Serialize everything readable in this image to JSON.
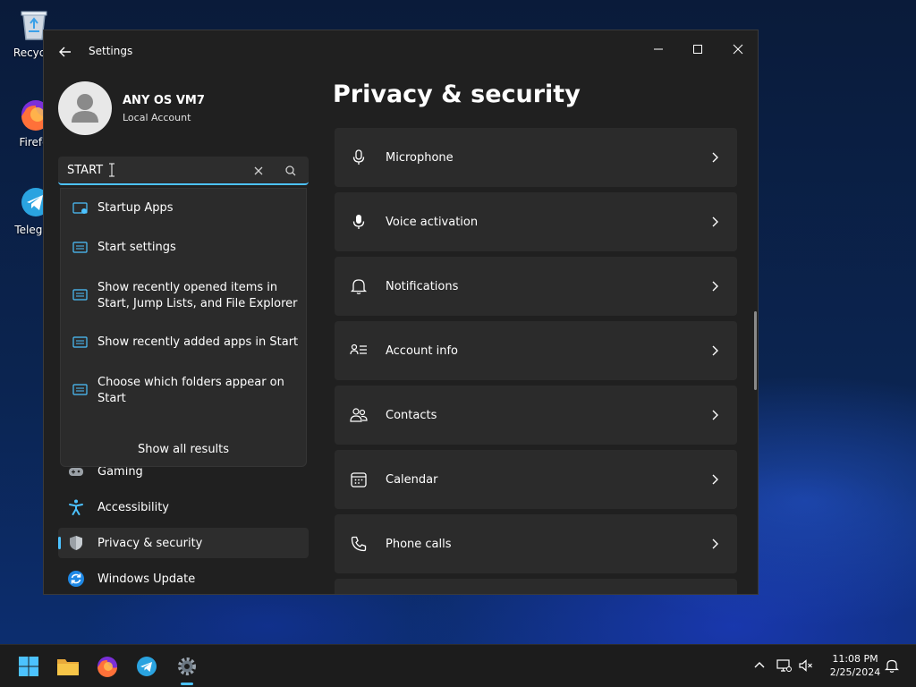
{
  "desktop": {
    "icons": [
      {
        "label": "Recycle",
        "icon": "recycle-bin-icon"
      },
      {
        "label": "Firefo",
        "icon": "firefox-icon"
      },
      {
        "label": "Telegra",
        "icon": "telegram-icon"
      }
    ]
  },
  "window": {
    "title": "Settings",
    "profile": {
      "name": "ANY OS VM7",
      "subtitle": "Local Account"
    },
    "search": {
      "value": "START",
      "suggestions": [
        "Startup Apps",
        "Start settings",
        "Show recently opened items in Start, Jump Lists, and File Explorer",
        "Show recently added apps in Start",
        "Choose which folders appear on Start"
      ],
      "show_all": "Show all results"
    },
    "nav": [
      {
        "label": "Gaming",
        "icon": "gaming-icon"
      },
      {
        "label": "Accessibility",
        "icon": "accessibility-icon"
      },
      {
        "label": "Privacy & security",
        "icon": "shield-icon",
        "active": true
      },
      {
        "label": "Windows Update",
        "icon": "windows-update-icon"
      }
    ],
    "page_title": "Privacy & security",
    "cards": [
      {
        "label": "Microphone",
        "icon": "microphone-icon"
      },
      {
        "label": "Voice activation",
        "icon": "voice-activation-icon"
      },
      {
        "label": "Notifications",
        "icon": "bell-icon"
      },
      {
        "label": "Account info",
        "icon": "account-info-icon"
      },
      {
        "label": "Contacts",
        "icon": "contacts-icon"
      },
      {
        "label": "Calendar",
        "icon": "calendar-icon"
      },
      {
        "label": "Phone calls",
        "icon": "phone-icon"
      }
    ]
  },
  "taskbar": {
    "apps": [
      "windows-start-icon",
      "file-explorer-icon",
      "firefox-icon",
      "telegram-icon",
      "settings-gear-icon"
    ],
    "time": "11:08 PM",
    "date": "2/25/2024"
  },
  "colors": {
    "accent": "#4cc2ff",
    "window_bg": "#202020",
    "card_bg": "#2b2b2b"
  }
}
